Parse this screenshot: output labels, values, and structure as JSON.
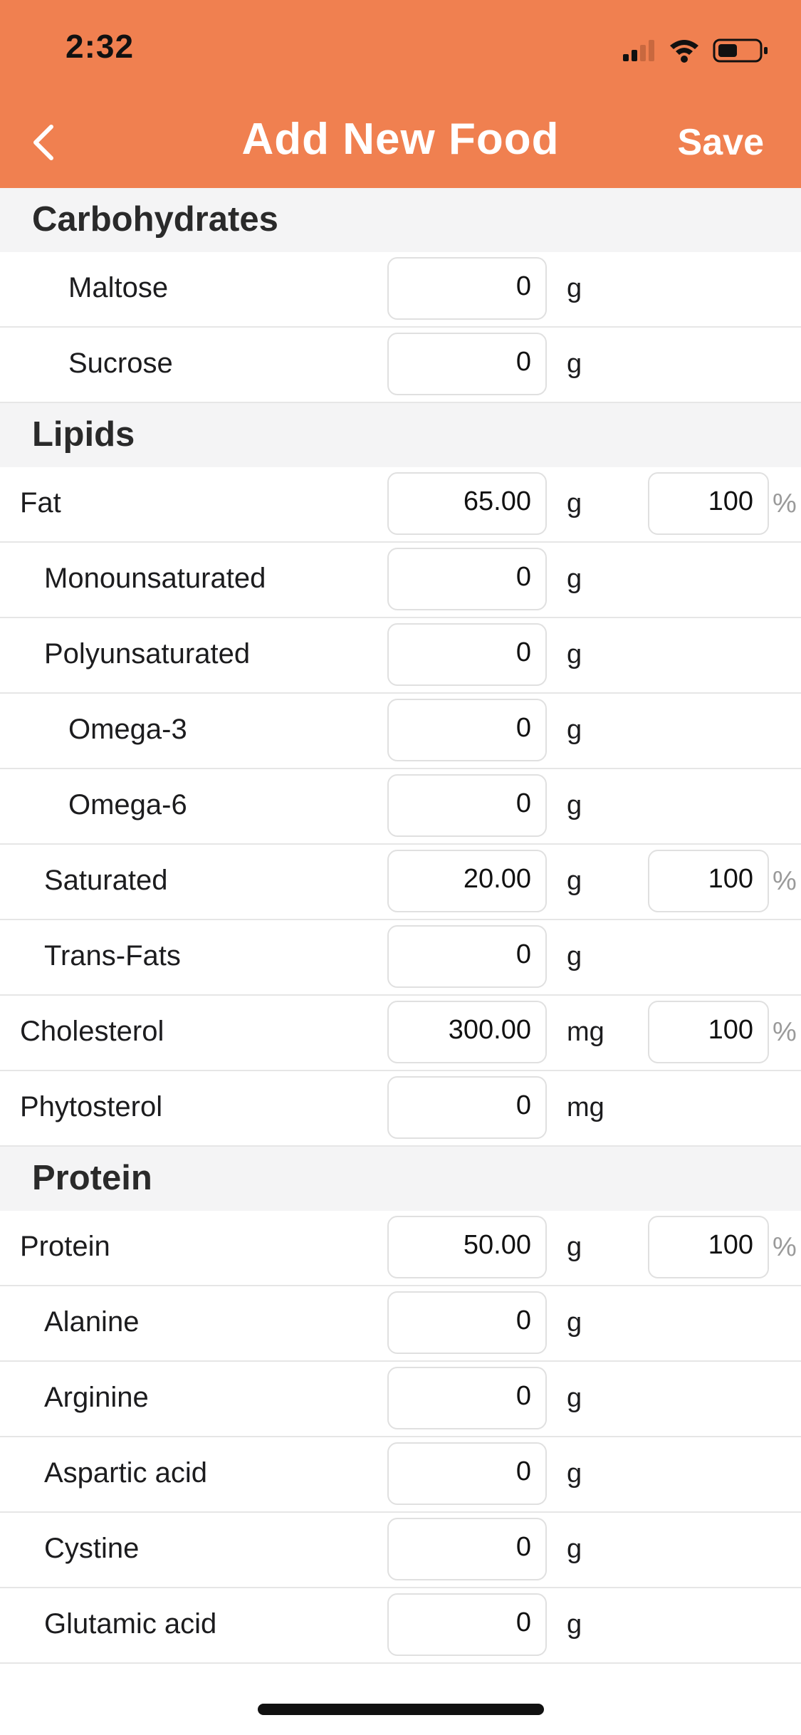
{
  "status_bar": {
    "time": "2:32"
  },
  "nav": {
    "title": "Add New Food",
    "save_label": "Save"
  },
  "colors": {
    "accent": "#F08050"
  },
  "sections": [
    {
      "title": "Carbohydrates",
      "rows": [
        {
          "label": "Maltose",
          "level": 2,
          "value": "0",
          "unit": "g"
        },
        {
          "label": "Sucrose",
          "level": 2,
          "value": "0",
          "unit": "g"
        }
      ]
    },
    {
      "title": "Lipids",
      "rows": [
        {
          "label": "Fat",
          "level": 0,
          "value": "65.00",
          "unit": "g",
          "pct": "100"
        },
        {
          "label": "Monounsaturated",
          "level": 1,
          "value": "0",
          "unit": "g"
        },
        {
          "label": "Polyunsaturated",
          "level": 1,
          "value": "0",
          "unit": "g"
        },
        {
          "label": "Omega-3",
          "level": 2,
          "value": "0",
          "unit": "g"
        },
        {
          "label": "Omega-6",
          "level": 2,
          "value": "0",
          "unit": "g"
        },
        {
          "label": "Saturated",
          "level": 1,
          "value": "20.00",
          "unit": "g",
          "pct": "100"
        },
        {
          "label": "Trans-Fats",
          "level": 1,
          "value": "0",
          "unit": "g"
        },
        {
          "label": "Cholesterol",
          "level": 0,
          "value": "300.00",
          "unit": "mg",
          "pct": "100"
        },
        {
          "label": "Phytosterol",
          "level": 0,
          "value": "0",
          "unit": "mg"
        }
      ]
    },
    {
      "title": "Protein",
      "rows": [
        {
          "label": "Protein",
          "level": 0,
          "value": "50.00",
          "unit": "g",
          "pct": "100"
        },
        {
          "label": "Alanine",
          "level": 1,
          "value": "0",
          "unit": "g"
        },
        {
          "label": "Arginine",
          "level": 1,
          "value": "0",
          "unit": "g"
        },
        {
          "label": "Aspartic acid",
          "level": 1,
          "value": "0",
          "unit": "g"
        },
        {
          "label": "Cystine",
          "level": 1,
          "value": "0",
          "unit": "g"
        },
        {
          "label": "Glutamic acid",
          "level": 1,
          "value": "0",
          "unit": "g"
        }
      ]
    }
  ],
  "pct_symbol": "%"
}
